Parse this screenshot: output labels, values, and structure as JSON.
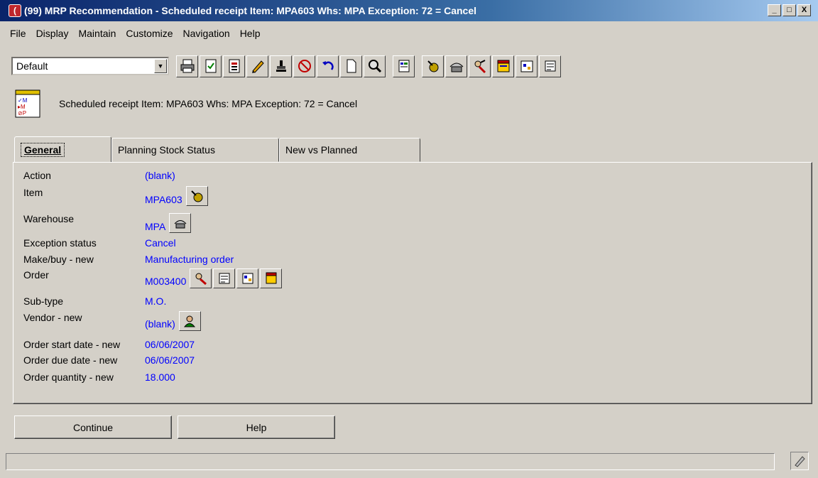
{
  "window": {
    "app_badge": "(",
    "title": "(99) MRP Recommendation - Scheduled receipt  Item: MPA603  Whs: MPA  Exception: 72 = Cancel",
    "minimize": "_",
    "maximize": "□",
    "close": "X"
  },
  "menu": [
    "File",
    "Display",
    "Maintain",
    "Customize",
    "Navigation",
    "Help"
  ],
  "toolbar": {
    "view_selected": "Default",
    "group1": [
      "printer-icon",
      "checklist-icon",
      "report-icon",
      "pencil-icon",
      "stamp-icon",
      "cancel-icon",
      "undo-icon",
      "new-document-icon",
      "find-icon"
    ],
    "group2": [
      "screen-icon"
    ],
    "group3": [
      "item-icon",
      "warehouse-icon",
      "order-icon",
      "planning-icon",
      "schedule-icon",
      "routing-icon"
    ]
  },
  "header": {
    "text": "Scheduled receipt  Item: MPA603  Whs: MPA  Exception: 72 = Cancel",
    "icon": "report-icon"
  },
  "tabs": [
    {
      "label": "General",
      "active": true
    },
    {
      "label": "Planning Stock Status",
      "active": false
    },
    {
      "label": "New vs Planned",
      "active": false
    }
  ],
  "fields": [
    {
      "label": "Action",
      "value": "(blank)",
      "buttons": []
    },
    {
      "label": "Item",
      "value": "MPA603",
      "buttons": [
        "item-icon"
      ]
    },
    {
      "label": "Warehouse",
      "value": "MPA",
      "buttons": [
        "warehouse-icon"
      ]
    },
    {
      "label": "Exception status",
      "value": "Cancel",
      "buttons": []
    },
    {
      "label": "Make/buy - new",
      "value": "Manufacturing order",
      "buttons": []
    },
    {
      "label": "Order",
      "value": "M003400",
      "buttons": [
        "order-icon",
        "routing-icon",
        "schedule-icon",
        "planning-icon"
      ]
    },
    {
      "label": "Sub-type",
      "value": "M.O.",
      "buttons": []
    },
    {
      "label": "Vendor - new",
      "value": "(blank)",
      "buttons": [
        "vendor-icon"
      ]
    },
    {
      "label": "Order start date - new",
      "value": "06/06/2007",
      "buttons": []
    },
    {
      "label": "Order due date - new",
      "value": "06/06/2007",
      "buttons": []
    },
    {
      "label": "Order quantity - new",
      "value": "18.000",
      "buttons": []
    }
  ],
  "buttons": {
    "continue": "Continue",
    "help": "Help"
  },
  "colors": {
    "value_text": "#0000ff",
    "titlebar_start": "#0a246a",
    "titlebar_end": "#a6caf0",
    "face": "#d4d0c8"
  }
}
